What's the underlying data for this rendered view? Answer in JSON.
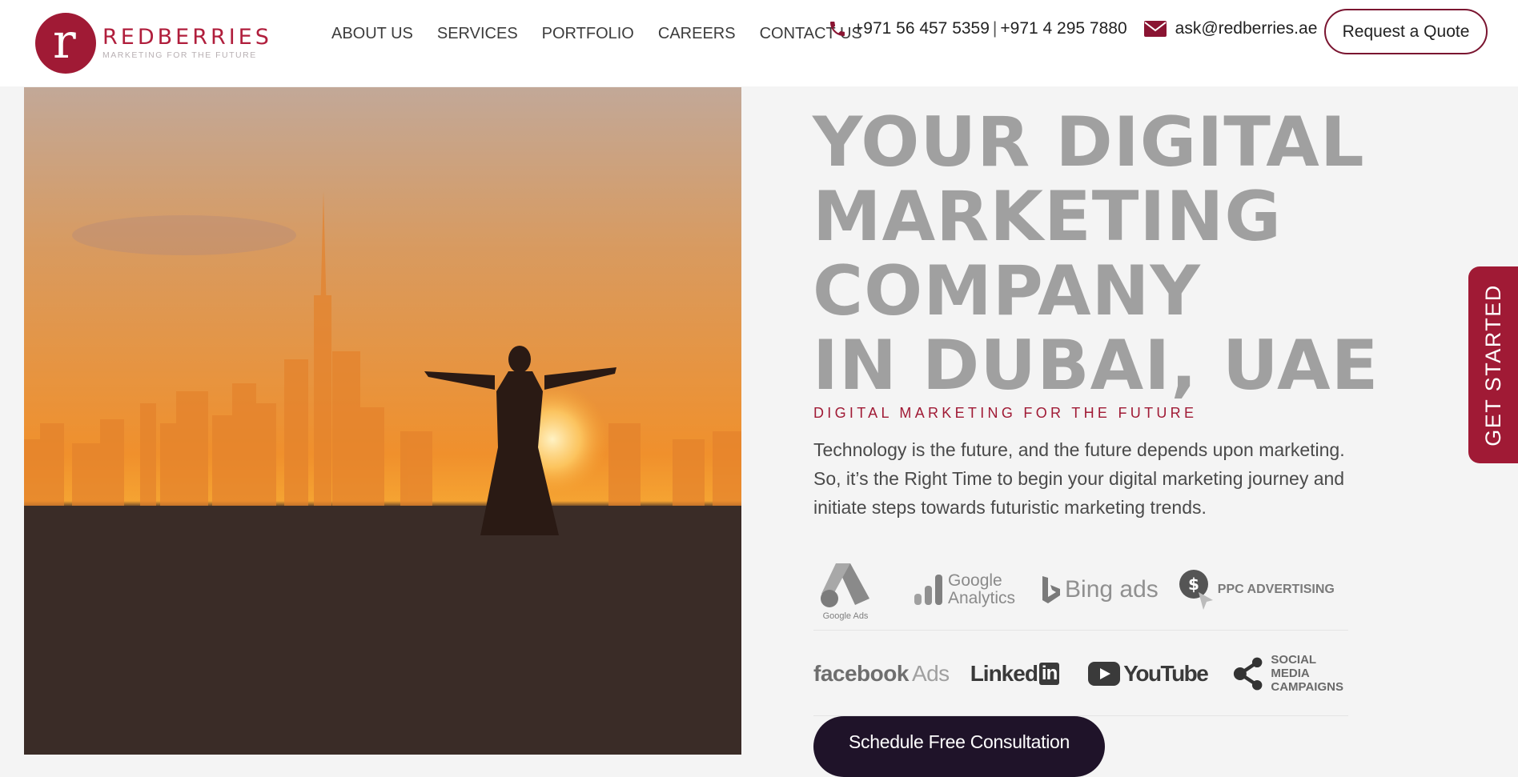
{
  "brand": {
    "logo_letter": "r",
    "name": "REDBERRIES",
    "tagline": "MARKETING FOR THE FUTURE",
    "color": "#a01a35"
  },
  "nav": {
    "items": [
      {
        "label": "ABOUT US"
      },
      {
        "label": "SERVICES"
      },
      {
        "label": "PORTFOLIO"
      },
      {
        "label": "CAREERS"
      },
      {
        "label": "CONTACT US"
      }
    ]
  },
  "contact": {
    "phone_icon": "phone-icon",
    "phone1": "+971 56 457 5359",
    "separator": "|",
    "phone2": "+971 4 295 7880",
    "email_icon": "mail-icon",
    "email": "ask@redberries.ae"
  },
  "header": {
    "quote_button": "Request a Quote"
  },
  "hero": {
    "headline_lines": [
      "YOUR DIGITAL",
      "MARKETING",
      "COMPANY",
      "IN DUBAI, UAE"
    ],
    "tagline": "DIGITAL MARKETING FOR THE FUTURE",
    "lead": "Technology is the future, and the future depends upon marketing. So, it’s the Right Time to begin your digital marketing journey and initiate steps towards futuristic marketing trends.",
    "cta": "Schedule Free Consultation"
  },
  "partners": {
    "google_ads": "Google Ads",
    "google_analytics_line1": "Google",
    "google_analytics_line2": "Analytics",
    "bing": "Bing ads",
    "ppc": "PPC ADVERTISING",
    "facebook": "facebook",
    "facebook_suffix": "Ads",
    "linkedin": "Linked",
    "linkedin_box": "in",
    "youtube": "YouTube",
    "social_line1": "SOCIAL MEDIA",
    "social_line2": "CAMPAIGNS"
  },
  "side_tab": {
    "label": "GET STARTED"
  }
}
